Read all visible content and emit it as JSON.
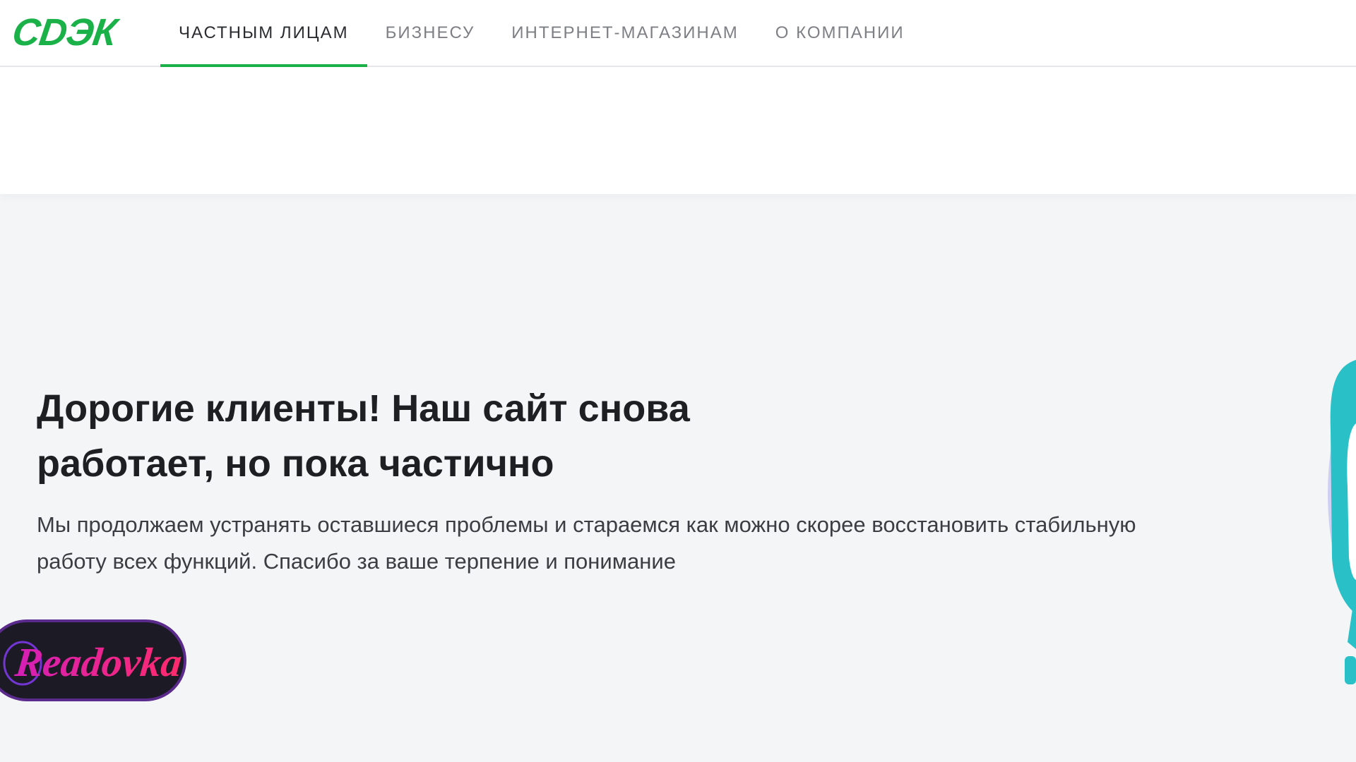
{
  "header": {
    "logo_text": "СDЭК",
    "nav": [
      {
        "label": "ЧАСТНЫМ ЛИЦАМ",
        "active": true
      },
      {
        "label": "БИЗНЕСУ",
        "active": false
      },
      {
        "label": "ИНТЕРНЕТ-МАГАЗИНАМ",
        "active": false
      },
      {
        "label": "О КОМПАНИИ",
        "active": false
      }
    ]
  },
  "notice": {
    "title": "Дорогие клиенты! Наш сайт снова работает, но пока частично",
    "text": "Мы продолжаем устранять оставшиеся проблемы и стараемся как можно скорее восстановить стабильную работу всех функций. Спасибо за ваше терпение и понимание"
  },
  "watermark": {
    "text": "Readovka"
  },
  "colors": {
    "brand_green": "#1ab248",
    "page_bg": "#f4f5f7",
    "title_text": "#1e1f22",
    "nav_inactive": "#7d7f84",
    "illustration_teal": "#29c1c7"
  }
}
